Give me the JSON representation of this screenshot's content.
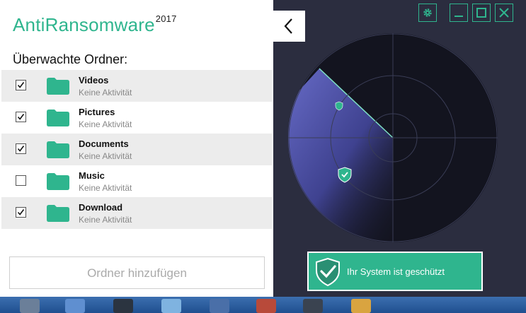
{
  "app": {
    "name": "AntiRansomware",
    "year": "2017"
  },
  "section_title": "Überwachte Ordner:",
  "folders": [
    {
      "name": "Videos",
      "status": "Keine Aktivität",
      "checked": true
    },
    {
      "name": "Pictures",
      "status": "Keine Aktivität",
      "checked": true
    },
    {
      "name": "Documents",
      "status": "Keine Aktivität",
      "checked": true
    },
    {
      "name": "Music",
      "status": "Keine Aktivität",
      "checked": false
    },
    {
      "name": "Download",
      "status": "Keine Aktivität",
      "checked": true
    }
  ],
  "add_folder_label": "Ordner hinzufügen",
  "status_label": "Ihr System ist geschützt",
  "icons": {
    "collapse": "chevron-left-icon",
    "settings": "gear-icon",
    "minimize": "minimize-icon",
    "maximize": "maximize-icon",
    "close": "close-icon",
    "folder": "folder-icon",
    "shield": "shield-check-icon"
  },
  "colors": {
    "accent": "#2fb58e",
    "background": "#2b2d3f",
    "radar": "#13141f",
    "sweep": "#5a5eb5"
  }
}
